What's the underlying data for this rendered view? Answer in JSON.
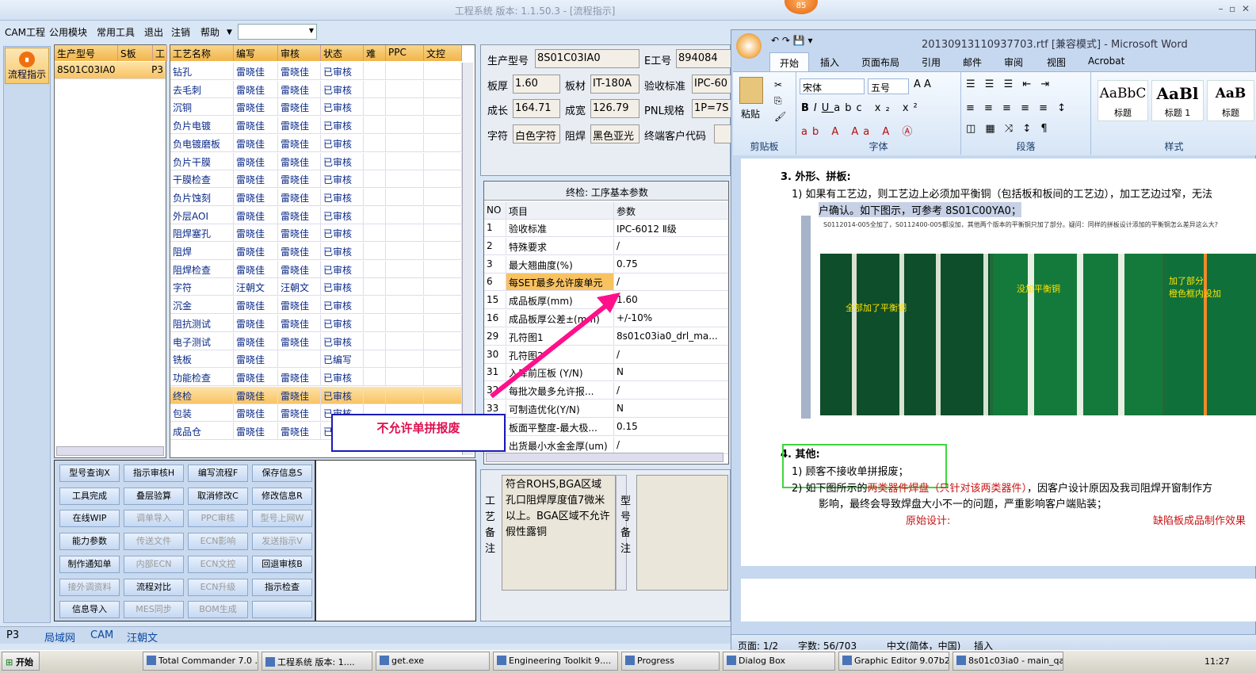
{
  "window": {
    "title": "工程系统  版本: 1.1.50.3 - [流程指示]",
    "badge": "85"
  },
  "menu": [
    "CAM工程",
    "公用模块",
    "常用工具",
    "退出",
    "注销",
    "帮助"
  ],
  "sidebar": {
    "flow_label": "流程指示"
  },
  "product_grid": {
    "headers": [
      "生产型号",
      "S板",
      "工"
    ],
    "row": [
      "8S01C03IA0",
      "",
      "P3"
    ]
  },
  "process_grid": {
    "headers": [
      "工艺名称",
      "编写",
      "审核",
      "状态",
      "难",
      "PPC",
      "文控"
    ],
    "rows": [
      [
        "钻孔",
        "雷晓佳",
        "雷晓佳",
        "已审核"
      ],
      [
        "去毛刺",
        "雷晓佳",
        "雷晓佳",
        "已审核"
      ],
      [
        "沉铜",
        "雷晓佳",
        "雷晓佳",
        "已审核"
      ],
      [
        "负片电镀",
        "雷晓佳",
        "雷晓佳",
        "已审核"
      ],
      [
        "负电镀磨板",
        "雷晓佳",
        "雷晓佳",
        "已审核"
      ],
      [
        "负片干膜",
        "雷晓佳",
        "雷晓佳",
        "已审核"
      ],
      [
        "干膜检查",
        "雷晓佳",
        "雷晓佳",
        "已审核"
      ],
      [
        "负片蚀刻",
        "雷晓佳",
        "雷晓佳",
        "已审核"
      ],
      [
        "外层AOI",
        "雷晓佳",
        "雷晓佳",
        "已审核"
      ],
      [
        "阻焊塞孔",
        "雷晓佳",
        "雷晓佳",
        "已审核"
      ],
      [
        "阻焊",
        "雷晓佳",
        "雷晓佳",
        "已审核"
      ],
      [
        "阻焊检查",
        "雷晓佳",
        "雷晓佳",
        "已审核"
      ],
      [
        "字符",
        "汪朝文",
        "汪朝文",
        "已审核"
      ],
      [
        "沉金",
        "雷晓佳",
        "雷晓佳",
        "已审核"
      ],
      [
        "阻抗测试",
        "雷晓佳",
        "雷晓佳",
        "已审核"
      ],
      [
        "电子测试",
        "雷晓佳",
        "雷晓佳",
        "已审核"
      ],
      [
        "铣板",
        "雷晓佳",
        "",
        "已编写"
      ],
      [
        "功能检查",
        "雷晓佳",
        "雷晓佳",
        "已审核"
      ],
      [
        "终检",
        "雷晓佳",
        "雷晓佳",
        "已审核"
      ],
      [
        "包装",
        "雷晓佳",
        "雷晓佳",
        "已审核"
      ],
      [
        "成品仓",
        "雷晓佳",
        "雷晓佳",
        "已"
      ]
    ]
  },
  "buttons": [
    [
      "型号查询X",
      "指示审核H",
      "编写流程F",
      "保存信息S"
    ],
    [
      "工具完成",
      "叠层验算",
      "取消修改C",
      "修改信息R"
    ],
    [
      "在线WIP",
      "调单导入",
      "PPC审核",
      "型号上网W"
    ],
    [
      "能力参数",
      "传送文件",
      "ECN影响",
      "发送指示V"
    ],
    [
      "制作通知单",
      "内部ECN",
      "ECN文控",
      "回退审核B"
    ],
    [
      "接外调资料",
      "流程对比",
      "ECN升级",
      "指示检查"
    ],
    [
      "信息导入",
      "MES同步",
      "BOM生成",
      ""
    ]
  ],
  "info": {
    "model_label": "生产型号",
    "model": "8S01C03IA0",
    "eno_label": "E工号",
    "eno": "894084",
    "thick_label": "板厚",
    "thick": "1.60",
    "mat_label": "板材",
    "mat": "IT-180A",
    "std_label": "验收标准",
    "std": "IPC-60",
    "len_label": "成长",
    "len": "164.71",
    "wid_label": "成宽",
    "wid": "126.79",
    "pnl_label": "PNL规格",
    "pnl": "1P=7S",
    "char_label": "字符",
    "char": "白色字符",
    "mask_label": "阻焊",
    "mask": "黑色亚光",
    "cust_label": "终端客户代码"
  },
  "params": {
    "title": "终检: 工序基本参数",
    "headers": [
      "NO",
      "项目",
      "参数"
    ],
    "rows": [
      [
        "1",
        "验收标准",
        "IPC-6012 Ⅱ级"
      ],
      [
        "2",
        "特殊要求",
        "/"
      ],
      [
        "3",
        "最大翘曲度(%)",
        "0.75"
      ],
      [
        "6",
        "每SET最多允许废单元",
        "/"
      ],
      [
        "15",
        "成品板厚(mm)",
        "1.60"
      ],
      [
        "16",
        "成品板厚公差±(mm)",
        "+/-10%"
      ],
      [
        "29",
        "孔符图1",
        "8s01c03ia0_drl_ma..."
      ],
      [
        "30",
        "孔符图2",
        "/"
      ],
      [
        "31",
        "入库前压板 (Y/N)",
        "N"
      ],
      [
        "32",
        "每批次最多允许报...",
        "/"
      ],
      [
        "33",
        "可制造优化(Y/N)",
        "N"
      ],
      [
        "34",
        "板面平整度-最大极...",
        "0.15"
      ],
      [
        "35",
        "出货最小水金金厚(um)",
        "/"
      ]
    ]
  },
  "callout": "不允许单拼报废",
  "remarks": {
    "label": "工艺备注",
    "text": "符合ROHS,BGA区域孔口阻焊厚度值7微米以上。BGA区域不允许假性露铜",
    "label2": "型号备注"
  },
  "bottom_tabs": [
    "P3",
    "局域网",
    "CAM",
    "汪朝文"
  ],
  "word": {
    "title": "20130913110937703.rtf [兼容模式] - Microsoft Word",
    "tabs": [
      "开始",
      "插入",
      "页面布局",
      "引用",
      "邮件",
      "审阅",
      "视图",
      "Acrobat"
    ],
    "font": "宋体",
    "size": "五号",
    "groups": [
      "剪贴板",
      "字体",
      "段落",
      "样式"
    ],
    "paste": "粘贴",
    "styles": [
      "AaBbC",
      "AaBl",
      "AaB"
    ],
    "style_names": [
      "标题",
      "标题 1",
      "标题"
    ],
    "doc": {
      "h3": "3.  外形、拼板:",
      "p1": "1)  如果有工艺边，则工艺边上必须加平衡铜（包括板和板间的工艺边），加工艺边过窄，无法",
      "p1b": "户确认。如下图示，可参考 8S01C00YA0；",
      "note": "S0112014-005全加了，S0112400-005都没加，其他两个版本的平衡铜只加了部分。疑问：同样的拼板设计添加的平衡铜怎么差异这么大?",
      "img_labels": [
        "全部加了平衡铜",
        "没加平衡铜",
        "加了部分",
        "橙色框内没加"
      ],
      "h4": "4.  其他:",
      "q1": "1)  顾客不接收单拼报废；",
      "q2a": "2)  如下图所示的",
      "q2red": "两类器件焊盘（只针对该两类器件）",
      "q2b": "，因客户设计原因及我司阻焊开窗制作方",
      "q2c": "影响，最终会导致焊盘大小不一的问题，严重影响客户端贴装；",
      "orig": "原始设计:",
      "defect": "缺陷板成品制作效果"
    },
    "status": {
      "page": "页面: 1/2",
      "words": "字数: 56/703",
      "lang": "中文(简体，中国)",
      "mode": "插入"
    }
  },
  "taskbar": {
    "start": "开始",
    "items": [
      "Total Commander 7.0 ...",
      "工程系统  版本: 1....",
      "get.exe",
      "Engineering Toolkit 9....",
      "Progress",
      "Dialog Box",
      "Graphic Editor 9.07b2...",
      "8s01c03ia0 - main_qa"
    ],
    "clock": "11:27"
  }
}
